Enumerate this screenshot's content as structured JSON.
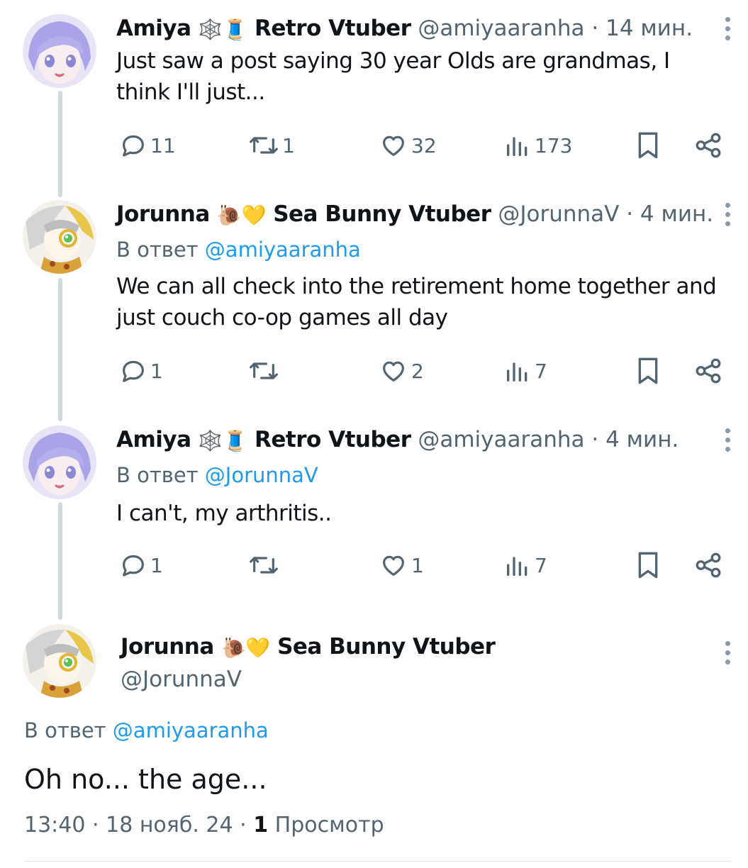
{
  "tweets": [
    {
      "name": "Amiya",
      "emoji": "🕸️🧵",
      "title": "Retro Vtuber",
      "handle": "@amiyaaranha",
      "time": "· 14 мин.",
      "reply_prefix": "",
      "reply_to": "",
      "text": "Just saw a post saying 30 year Olds are grandmas, I think I'll just...",
      "replies": "11",
      "retweets": "1",
      "likes": "32",
      "views": "173"
    },
    {
      "name": "Jorunna",
      "emoji": "🐌💛",
      "title": "Sea Bunny Vtuber",
      "handle": "@JorunnaV",
      "time": "· 4 мин.",
      "reply_prefix": "В ответ",
      "reply_to": "@amiyaaranha",
      "text": "We can all check into the retirement home together and just couch co-op games all day",
      "replies": "1",
      "retweets": "",
      "likes": "2",
      "views": "7"
    },
    {
      "name": "Amiya",
      "emoji": "🕸️🧵",
      "title": "Retro Vtuber",
      "handle": "@amiyaaranha",
      "time": "· 4 мин.",
      "reply_prefix": "В ответ",
      "reply_to": "@JorunnaV",
      "text": "I can't, my arthritis..",
      "replies": "1",
      "retweets": "",
      "likes": "1",
      "views": "7"
    }
  ],
  "main": {
    "name": "Jorunna",
    "emoji": "🐌💛",
    "title": "Sea Bunny Vtuber",
    "handle": "@JorunnaV",
    "reply_prefix": "В ответ",
    "reply_to": "@amiyaaranha",
    "text": "Oh no... the age...",
    "time": "13:40",
    "date": "18 нояб. 24",
    "views_count": "1",
    "views_label": "Просмотр"
  },
  "icons": [
    "reply-icon",
    "retweet-icon",
    "like-icon",
    "views-icon",
    "bookmark-icon",
    "share-icon",
    "more-icon"
  ],
  "colors": {
    "link": "#1d9bf0",
    "muted": "#536471",
    "text": "#0f1419",
    "thread": "#cfd9de"
  }
}
